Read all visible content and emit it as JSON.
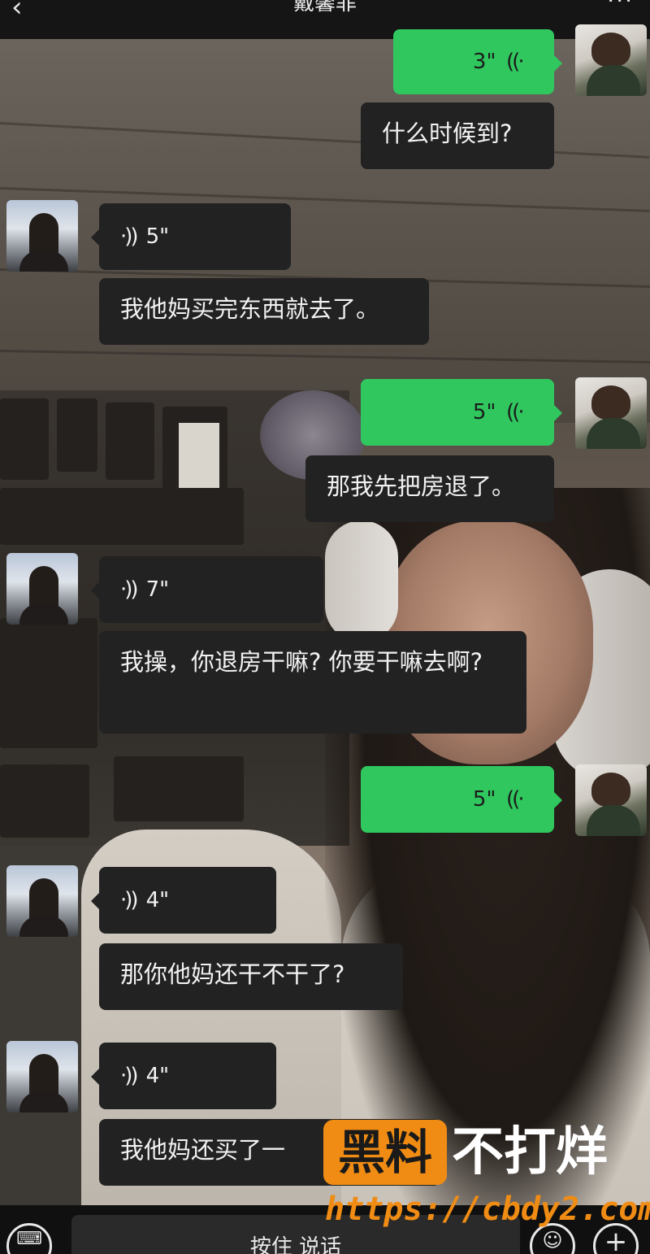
{
  "header": {
    "back_icon": "‹",
    "title": "戴馨菲",
    "more_icon": "···"
  },
  "messages": [
    {
      "side": "out",
      "type": "voice",
      "duration": "3\""
    },
    {
      "side": "out",
      "type": "text",
      "text": "什么时候到?"
    },
    {
      "side": "in",
      "type": "voice",
      "duration": "5\""
    },
    {
      "side": "in",
      "type": "text",
      "text": "我他妈买完东西就去了。"
    },
    {
      "side": "out",
      "type": "voice",
      "duration": "5\""
    },
    {
      "side": "out",
      "type": "text",
      "text": "那我先把房退了。"
    },
    {
      "side": "in",
      "type": "voice",
      "duration": "7\""
    },
    {
      "side": "in",
      "type": "text",
      "text": "我操，你退房干嘛? 你要干嘛去啊?"
    },
    {
      "side": "out",
      "type": "voice",
      "duration": "5\""
    },
    {
      "side": "in",
      "type": "voice",
      "duration": "4\""
    },
    {
      "side": "in",
      "type": "text",
      "text": "那你他妈还干不干了?"
    },
    {
      "side": "in",
      "type": "voice",
      "duration": "4\""
    },
    {
      "side": "in",
      "type": "text",
      "text": "我他妈还买了一"
    }
  ],
  "icons": {
    "voice_wave": "·))",
    "keyboard": "⌨",
    "emoji": "☺",
    "plus": "+"
  },
  "input_bar": {
    "hold_to_talk": "按住 说话"
  },
  "watermark": {
    "box_text": "黑料",
    "text": "不打烊",
    "url": "https://cbdy2.com",
    "box_color": "#f08c14"
  },
  "colors": {
    "green_bubble": "#2fc75e",
    "dark_bubble": "#222222"
  }
}
